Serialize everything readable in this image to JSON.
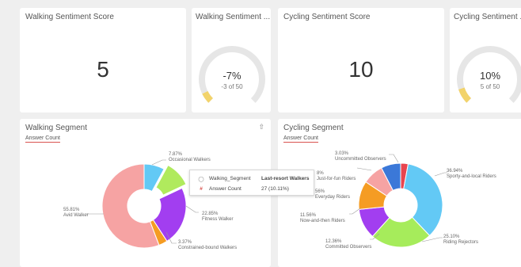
{
  "cards": {
    "walking_score": {
      "title": "Walking Sentiment Score",
      "value": "5"
    },
    "walking_gauge": {
      "title": "Walking Sentiment ...",
      "percent": "-7%",
      "sub": "-3  of 50",
      "fraction": 0.07,
      "color": "#f2d36b"
    },
    "cycling_score": {
      "title": "Cycling Sentiment Score",
      "value": "10"
    },
    "cycling_gauge": {
      "title": "Cycling Sentiment ...",
      "percent": "10%",
      "sub": "5  of 50",
      "fraction": 0.1,
      "color": "#f2d36b"
    }
  },
  "walking_segment": {
    "title": "Walking Segment",
    "subtitle": "Answer Count",
    "icon": "upload-icon",
    "labels": {
      "occasional": {
        "pct": "7.87%",
        "name": "Occasional Walkers"
      },
      "fitness": {
        "pct": "22.85%",
        "name": "Fitness Walker"
      },
      "constrained": {
        "pct": "3.37%",
        "name": "Constrained-bound Walkers"
      },
      "avid": {
        "pct": "55.81%",
        "name": "Avid Walker"
      }
    },
    "tooltip": {
      "row1_key": "Walking_Segment",
      "row1_val": "Last-resort Walkers",
      "row2_key": "Answer Count",
      "row2_val": "27 (10.11%)"
    }
  },
  "cycling_segment": {
    "title": "Cycling Segment",
    "subtitle": "Answer Count",
    "labels": {
      "uncommitted": {
        "pct": "3.03%",
        "name": "Uncommitted Observers"
      },
      "justforfun": {
        "pct": "8%",
        "name": "Just-for-fun Riders"
      },
      "everyday": {
        "pct": "56%",
        "name": "Everyday Riders"
      },
      "sporty": {
        "pct": "36.94%",
        "name": "Sporty-and-local Riders"
      },
      "nowandthen": {
        "pct": "11.56%",
        "name": "Now-and-then Riders"
      },
      "committed": {
        "pct": "12.36%",
        "name": "Committed Observers"
      },
      "riding": {
        "pct": "25.10%",
        "name": "Riding Rejectors"
      }
    }
  },
  "chart_data": [
    {
      "type": "pie",
      "title": "Walking Segment",
      "subtitle": "Answer Count",
      "slices": [
        {
          "label": "Occasional Walkers",
          "value": 7.87,
          "color": "#63c9f5"
        },
        {
          "label": "Last-resort Walkers",
          "value": 10.11,
          "color": "#b0ea5d"
        },
        {
          "label": "Fitness Walker",
          "value": 22.85,
          "color": "#a23ef0"
        },
        {
          "label": "Constrained-bound Walkers",
          "value": 3.37,
          "color": "#f59c23"
        },
        {
          "label": "Avid Walker",
          "value": 55.81,
          "color": "#f6a3a3"
        }
      ]
    },
    {
      "type": "pie",
      "title": "Cycling Segment",
      "subtitle": "Answer Count",
      "slices": [
        {
          "label": "Uncommitted Observers",
          "value": 3.03,
          "color": "#e8454f"
        },
        {
          "label": "Sporty-and-local Riders",
          "value": 36.94,
          "color": "#63c9f5"
        },
        {
          "label": "Riding Rejectors",
          "value": 25.1,
          "color": "#a6ec5b"
        },
        {
          "label": "Committed Observers",
          "value": 12.36,
          "color": "#a23ef0"
        },
        {
          "label": "Now-and-then Riders",
          "value": 11.56,
          "color": "#f59c23"
        },
        {
          "label": "Everyday Riders",
          "value": 8.5,
          "color": "#f6a3a3"
        },
        {
          "label": "Just-for-fun Riders",
          "value": 8.0,
          "color": "#3b78d8"
        }
      ]
    }
  ]
}
